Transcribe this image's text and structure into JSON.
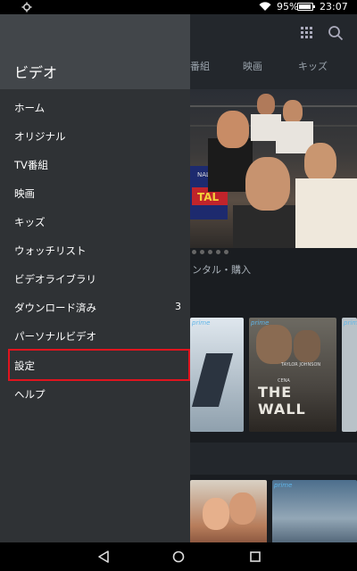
{
  "status_bar": {
    "battery_percent_label": "95%",
    "battery_level": 0.95,
    "time": "23:07",
    "icons": [
      "gear-icon",
      "wifi-icon",
      "battery-icon"
    ]
  },
  "background": {
    "tabs": [
      "番組",
      "映画",
      "キッズ"
    ],
    "hero_poster_text": [
      "NAL",
      "TAL"
    ],
    "section_label": "ンタル・購入",
    "poster_prime_tag": "prime",
    "poster_names": "TAYLOR JOHNSON",
    "poster_cena": "CENA",
    "poster_title": "THE WALL",
    "icons": [
      "grid-icon",
      "search-icon"
    ]
  },
  "drawer": {
    "title": "ビデオ",
    "items": [
      {
        "label": "ホーム",
        "count": ""
      },
      {
        "label": "オリジナル",
        "count": ""
      },
      {
        "label": "TV番組",
        "count": ""
      },
      {
        "label": "映画",
        "count": ""
      },
      {
        "label": "キッズ",
        "count": ""
      },
      {
        "label": "ウォッチリスト",
        "count": ""
      },
      {
        "label": "ビデオライブラリ",
        "count": ""
      },
      {
        "label": "ダウンロード済み",
        "count": "3"
      },
      {
        "label": "パーソナルビデオ",
        "count": ""
      },
      {
        "label": "設定",
        "count": ""
      },
      {
        "label": "ヘルプ",
        "count": ""
      }
    ],
    "highlighted_item": "設定",
    "highlight_color": "#e0141e"
  },
  "nav_bar": {
    "icons": [
      "back-icon",
      "home-icon",
      "recents-icon"
    ]
  }
}
